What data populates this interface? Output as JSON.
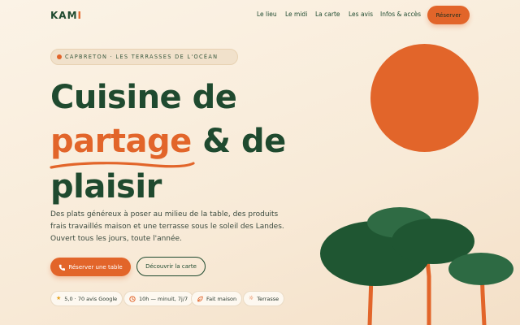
{
  "brand": {
    "name_main": "KAM",
    "name_accent": "I"
  },
  "nav": {
    "items": [
      "Le lieu",
      "Le midi",
      "La carte",
      "Les avis",
      "Infos & accès"
    ],
    "reserve_label": "Réserver"
  },
  "hero": {
    "location": "CAPBRETON · LES TERRASSES DE L'OCÉAN",
    "title_line1": "Cuisine de",
    "title_accent": "partage",
    "title_line2_rest": " & de",
    "title_line3": "plaisir",
    "lead": "Des plats généreux à poser au milieu de la table, des produits frais travaillés maison et une terrasse sous le soleil des Landes. Ouvert tous les jours, toute l'année.",
    "cta_primary": "Réserver une table",
    "cta_secondary": "Découvrir la carte"
  },
  "chips": [
    {
      "icon": "star-icon",
      "label": "5,0 · 70 avis Google"
    },
    {
      "icon": "clock-icon",
      "label": "10h — minuit, 7j/7"
    },
    {
      "icon": "leaf-icon",
      "label": "Fait maison"
    },
    {
      "icon": "sun-icon",
      "label": "Terrasse"
    }
  ],
  "colors": {
    "accent": "#e2652a",
    "primary": "#1f4a2f",
    "background": "#fbf3e6"
  }
}
